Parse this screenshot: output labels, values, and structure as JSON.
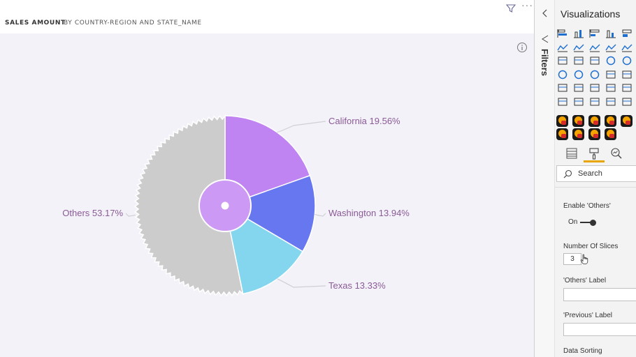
{
  "report": {
    "header": {
      "title": "SALES AMOUNT",
      "subtitle": "BY COUNTRY-REGION AND STATE_NAME"
    },
    "canvas_background": "#f3f2f8"
  },
  "chart_data": {
    "type": "pie",
    "categories": [
      "California",
      "Washington",
      "Texas",
      "Others"
    ],
    "values": [
      19.56,
      13.94,
      13.33,
      53.17
    ],
    "labels": [
      "California 19.56%",
      "Washington 13.94%",
      "Texas 13.33%",
      "Others 53.17%"
    ],
    "colors": [
      "#c084f2",
      "#6677f0",
      "#84d6ee",
      "#cccccc"
    ],
    "center_circle_color": "#cc99f5",
    "label_color": "#8a5a96",
    "others_edge": "jagged",
    "start_angle": "12 o'clock, clockwise"
  },
  "filters_strip": {
    "label": "Filters"
  },
  "viz_pane": {
    "title": "Visualizations",
    "builtin_icons": [
      "stacked-bar-icon",
      "stacked-column-icon",
      "clustered-bar-icon",
      "clustered-column-icon",
      "100-bar-icon",
      "line-chart-icon",
      "area-chart-icon",
      "stacked-area-icon",
      "line-column-icon",
      "ribbon-chart-icon",
      "waterfall-icon",
      "funnel-icon",
      "scatter-icon",
      "pie-chart-icon",
      "donut-chart-icon",
      "map-icon",
      "filled-map-icon",
      "gauge-icon",
      "card-icon",
      "multirow-card-icon",
      "kpi-icon",
      "table-icon",
      "matrix-icon",
      "key-influencers-icon",
      "decomposition-tree-icon",
      "page-icon",
      "paginated-report-icon",
      "powerapps-icon",
      "power-automate-icon",
      "chevron-visual-icon"
    ],
    "custom_icon_count": 9,
    "tabs": [
      "fields-tab-icon",
      "format-tab-icon",
      "analytics-tab-icon"
    ],
    "accent": "#e8a500",
    "search": {
      "placeholder": "Search"
    },
    "properties": {
      "enable_others_label": "Enable 'Others'",
      "enable_others_state": "On",
      "num_slices_label": "Number Of Slices",
      "num_slices_value": "3",
      "others_label_label": "'Others' Label",
      "others_label_value": "",
      "previous_label_label": "'Previous' Label",
      "previous_label_value": "",
      "data_sorting_label": "Data Sorting"
    }
  }
}
